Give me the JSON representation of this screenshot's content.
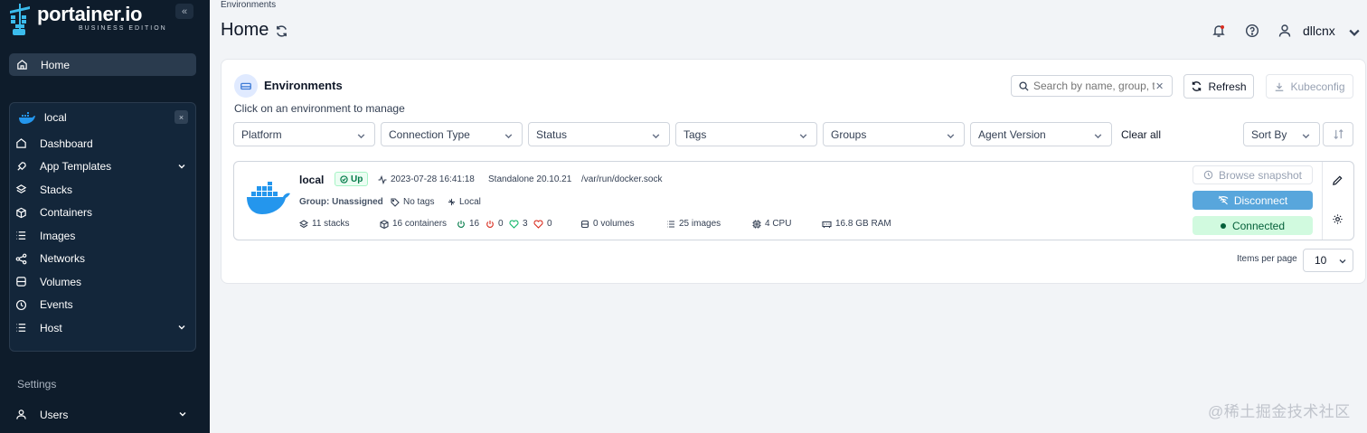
{
  "sidebar": {
    "logo_title": "portainer.io",
    "logo_subtitle": "BUSINESS EDITION",
    "collapse_glyph": "«",
    "home_label": "Home",
    "environment": {
      "name": "local",
      "close_glyph": "×",
      "items": [
        {
          "label": "Dashboard",
          "icon": "dashboard-icon"
        },
        {
          "label": "App Templates",
          "icon": "rocket-icon",
          "expandable": true
        },
        {
          "label": "Stacks",
          "icon": "layers-icon"
        },
        {
          "label": "Containers",
          "icon": "box-icon"
        },
        {
          "label": "Images",
          "icon": "list-icon"
        },
        {
          "label": "Networks",
          "icon": "share-icon"
        },
        {
          "label": "Volumes",
          "icon": "database-icon"
        },
        {
          "label": "Events",
          "icon": "history-icon"
        },
        {
          "label": "Host",
          "icon": "host-icon",
          "expandable": true
        }
      ]
    },
    "settings_label": "Settings",
    "users_label": "Users"
  },
  "header": {
    "breadcrumb": "Environments",
    "title": "Home",
    "username": "dllcnx"
  },
  "panel": {
    "title": "Environments",
    "subtitle": "Click on an environment to manage",
    "search_placeholder": "Search by name, group, tag, status, URL...",
    "search_visible_text": "Search by name, group, t",
    "refresh_label": "Refresh",
    "kubeconfig_label": "Kubeconfig",
    "filters": [
      "Platform",
      "Connection Type",
      "Status",
      "Tags",
      "Groups",
      "Agent Version"
    ],
    "clear_all_label": "Clear all",
    "sort_label": "Sort By",
    "items_per_page_label": "Items per page",
    "items_per_page_value": "10"
  },
  "env_card": {
    "name": "local",
    "status": "Up",
    "timestamp": "2023-07-28 16:41:18",
    "type": "Standalone 20.10.21",
    "url": "/var/run/docker.sock",
    "group": "Group: Unassigned",
    "tags": "No tags",
    "location": "Local",
    "stacks": "11 stacks",
    "containers": "16 containers",
    "running": "16",
    "stopped": "0",
    "healthy": "3",
    "unhealthy": "0",
    "volumes": "0 volumes",
    "images": "25 images",
    "cpu": "4 CPU",
    "ram": "16.8 GB RAM",
    "browse_snapshot": "Browse snapshot",
    "disconnect": "Disconnect",
    "connected": "Connected"
  },
  "watermark": "@稀土掘金技术社区",
  "colors": {
    "sidebar_bg": "#0e1c2b",
    "accent_blue": "#58a6dc",
    "success_green": "#027a48",
    "danger_red": "#d92d20"
  }
}
